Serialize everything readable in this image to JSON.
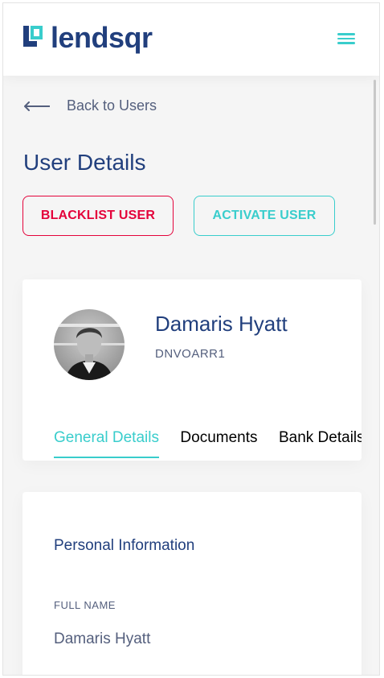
{
  "brand": {
    "name": "lendsqr",
    "logo_color": "#213F7D",
    "mark_color": "#39CDCC"
  },
  "header": {
    "menu_icon": "hamburger-icon"
  },
  "nav": {
    "back_icon": "arrow-left-icon",
    "back_label": "Back to Users"
  },
  "page": {
    "title": "User Details"
  },
  "actions": {
    "blacklist_label": "BLACKLIST USER",
    "activate_label": "ACTIVATE USER",
    "blacklist_color": "#E4033B",
    "activate_color": "#39CDCC"
  },
  "profile": {
    "name": "Damaris Hyatt",
    "code": "DNVOARR1",
    "avatar": "user-avatar-photo"
  },
  "tabs": [
    {
      "label": "General Details",
      "active": true
    },
    {
      "label": "Documents",
      "active": false
    },
    {
      "label": "Bank Details",
      "active": false
    }
  ],
  "personal_info": {
    "section_title": "Personal Information",
    "fields": [
      {
        "label": "FULL NAME",
        "value": "Damaris Hyatt"
      }
    ]
  }
}
